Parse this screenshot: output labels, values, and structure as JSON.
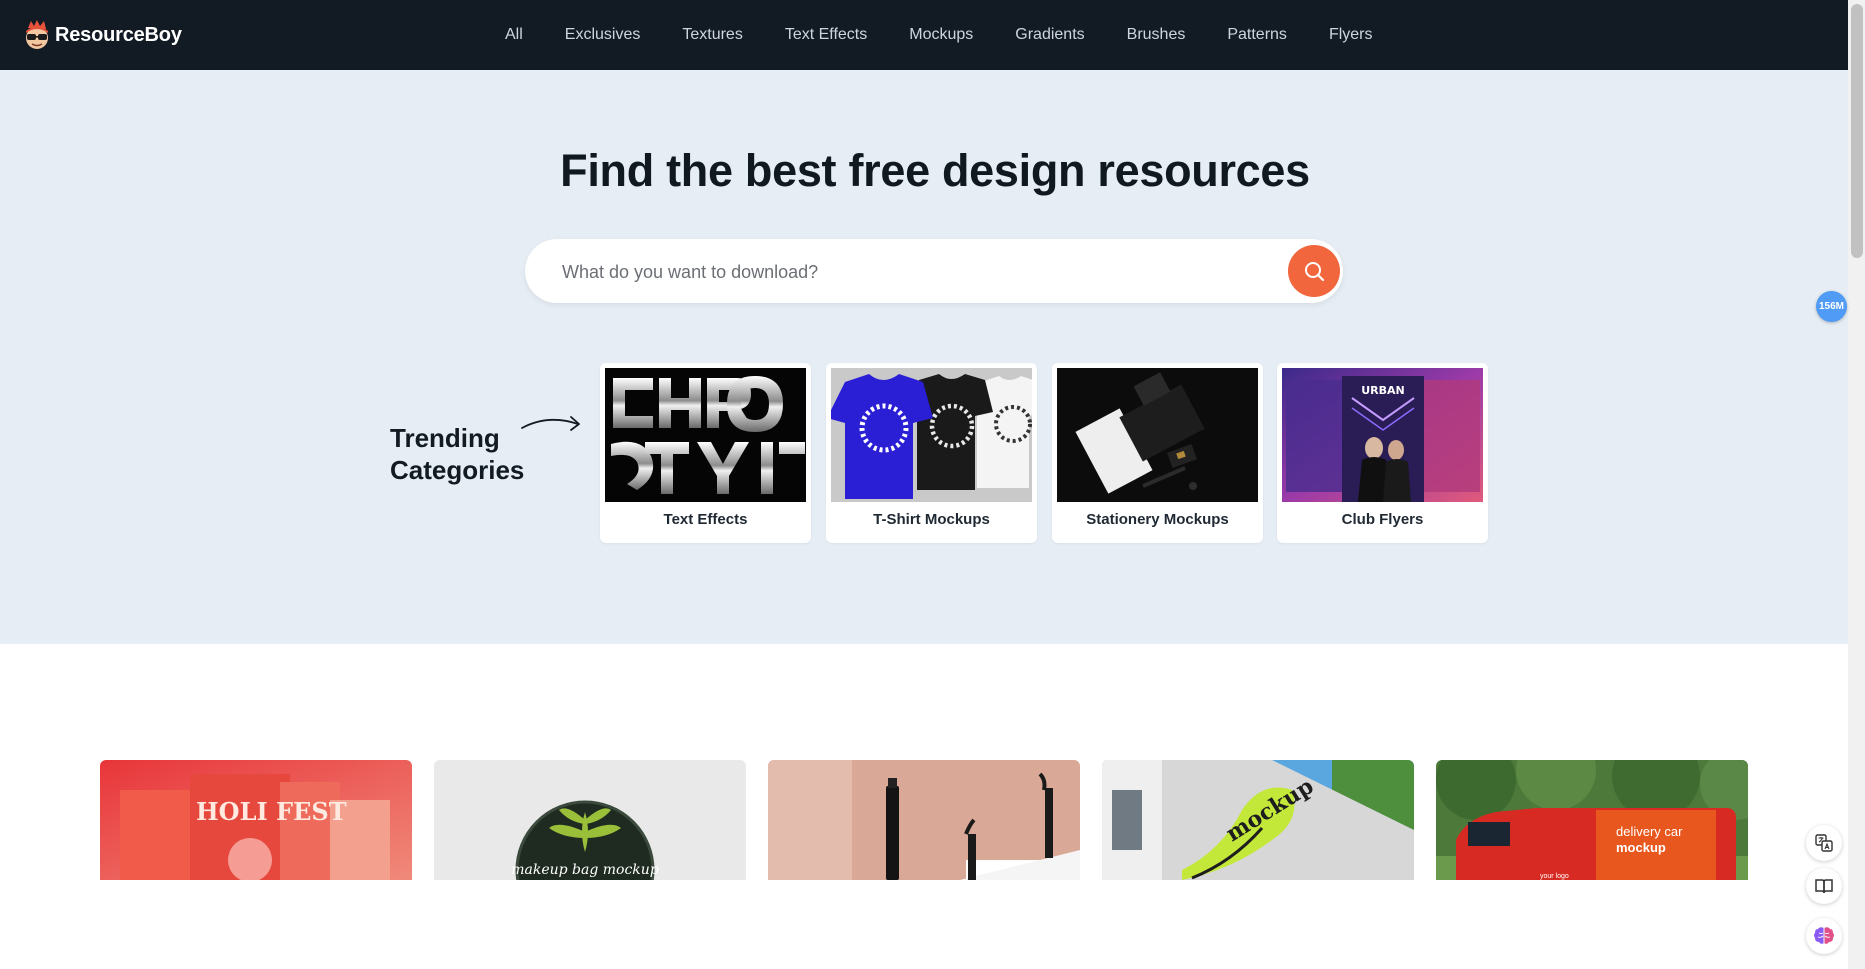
{
  "header": {
    "brand": "ResourceBoy",
    "nav": [
      {
        "label": "All"
      },
      {
        "label": "Exclusives"
      },
      {
        "label": "Textures"
      },
      {
        "label": "Text Effects"
      },
      {
        "label": "Mockups"
      },
      {
        "label": "Gradients"
      },
      {
        "label": "Brushes"
      },
      {
        "label": "Patterns"
      },
      {
        "label": "Flyers"
      }
    ]
  },
  "hero": {
    "headline": "Find the best free design resources",
    "search_placeholder": "What do you want to download?",
    "trending_line1": "Trending",
    "trending_line2": "Categories",
    "categories": [
      {
        "label": "Text Effects"
      },
      {
        "label": "T-Shirt Mockups"
      },
      {
        "label": "Stationery Mockups"
      },
      {
        "label": "Club Flyers"
      }
    ],
    "tshirt_print": "EAT · SLEEP · DESIGN · REPEAT ·",
    "flyer_title": "URBAN"
  },
  "grid": {
    "cards": [
      {
        "text": "HOLI FEST"
      },
      {
        "text": "makeup bag mockup"
      },
      {
        "text": ""
      },
      {
        "text": "mockup"
      },
      {
        "text_main": "delivery car",
        "text_sub": "mockup",
        "text_logo": "your logo"
      }
    ]
  },
  "widgets": {
    "badge": "156M"
  },
  "colors": {
    "nav_bg": "#121a23",
    "hero_bg": "#e6edf4",
    "accent": "#f2663e",
    "badge": "#4f9bf5"
  }
}
